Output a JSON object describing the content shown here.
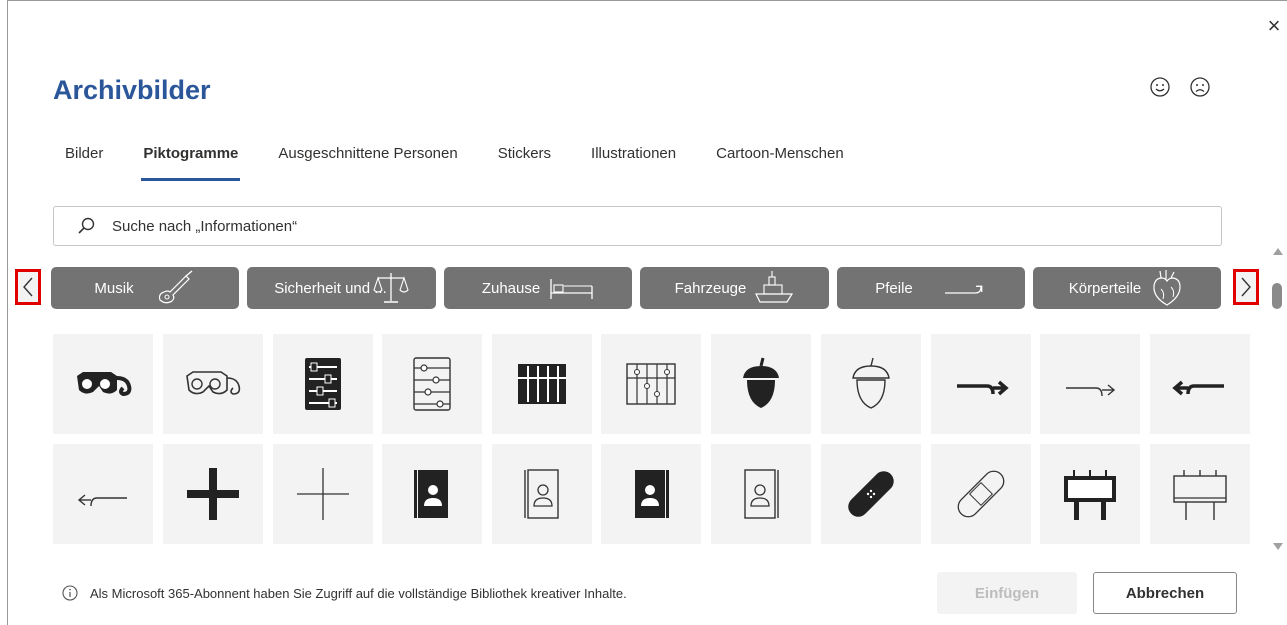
{
  "dialog": {
    "title": "Archivbilder",
    "close_label": "×"
  },
  "feedback": {
    "happy_icon": "smiley-happy-icon",
    "sad_icon": "smiley-sad-icon"
  },
  "tabs": [
    {
      "label": "Bilder",
      "active": false
    },
    {
      "label": "Piktogramme",
      "active": true
    },
    {
      "label": "Ausgeschnittene Personen",
      "active": false
    },
    {
      "label": "Stickers",
      "active": false
    },
    {
      "label": "Illustrationen",
      "active": false
    },
    {
      "label": "Cartoon-Menschen",
      "active": false
    }
  ],
  "search": {
    "placeholder": "Suche nach „Informationen“",
    "value": ""
  },
  "categories": [
    {
      "label": "Musik",
      "icon": "guitar-icon"
    },
    {
      "label": "Sicherheit und ...",
      "icon": "scales-icon"
    },
    {
      "label": "Zuhause",
      "icon": "bed-icon"
    },
    {
      "label": "Fahrzeuge",
      "icon": "ship-icon"
    },
    {
      "label": "Pfeile",
      "icon": "arrow-icon"
    },
    {
      "label": "Körperteile",
      "icon": "heart-organ-icon"
    }
  ],
  "icons_row1": [
    "3d-glasses-filled",
    "3d-glasses-outline",
    "abacus-filled",
    "abacus-outline",
    "abacus-wide-filled",
    "abacus-wide-outline",
    "acorn-filled",
    "acorn-outline",
    "arrow-turn-right-filled",
    "arrow-turn-right-outline",
    "arrow-turn-left-filled"
  ],
  "icons_row2": [
    "arrow-turn-left-outline",
    "plus-filled",
    "plus-outline",
    "address-book-filled",
    "address-book-outline",
    "address-book-filled-2",
    "address-book-outline-2",
    "bandage-filled",
    "bandage-outline",
    "billboard-filled",
    "billboard-outline"
  ],
  "footer": {
    "info_text": "Als Microsoft 365-Abonnent haben Sie Zugriff auf die vollständige Bibliothek kreativer Inhalte.",
    "insert_label": "Einfügen",
    "cancel_label": "Abbrechen"
  },
  "colors": {
    "accent": "#2b579a",
    "category_bg": "#737373",
    "highlight": "#e00000"
  }
}
